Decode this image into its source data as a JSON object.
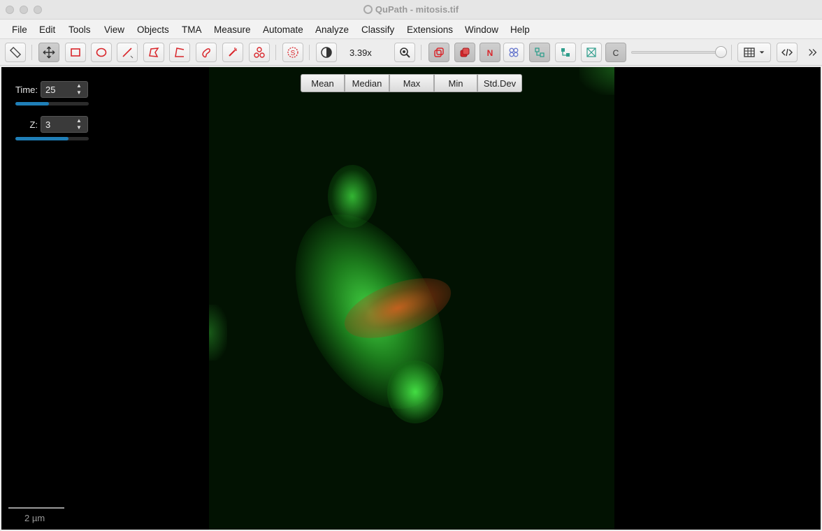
{
  "window": {
    "title": "QuPath - mitosis.tif"
  },
  "menu": [
    "File",
    "Edit",
    "Tools",
    "View",
    "Objects",
    "TMA",
    "Measure",
    "Automate",
    "Analyze",
    "Classify",
    "Extensions",
    "Window",
    "Help"
  ],
  "toolbar": {
    "zoom": "3.39x",
    "selection_mode_label": "S",
    "n_toggle_label": "N",
    "channel_toggle_label": "C",
    "opacity_level": 1.0
  },
  "viewer": {
    "projection_buttons": [
      "Mean",
      "Median",
      "Max",
      "Min",
      "Std.Dev"
    ],
    "time": {
      "label": "Time:",
      "value": "25",
      "level": 0.46
    },
    "z": {
      "label": "Z:",
      "value": "3",
      "level": 0.72
    },
    "scalebar": "2 µm"
  },
  "colors": {
    "accent": "#d9262b",
    "teal": "#2f9e8c",
    "slider_fill": "#1f7fb8",
    "green_channel": "#3fd43f",
    "red_channel": "#d9572a"
  }
}
